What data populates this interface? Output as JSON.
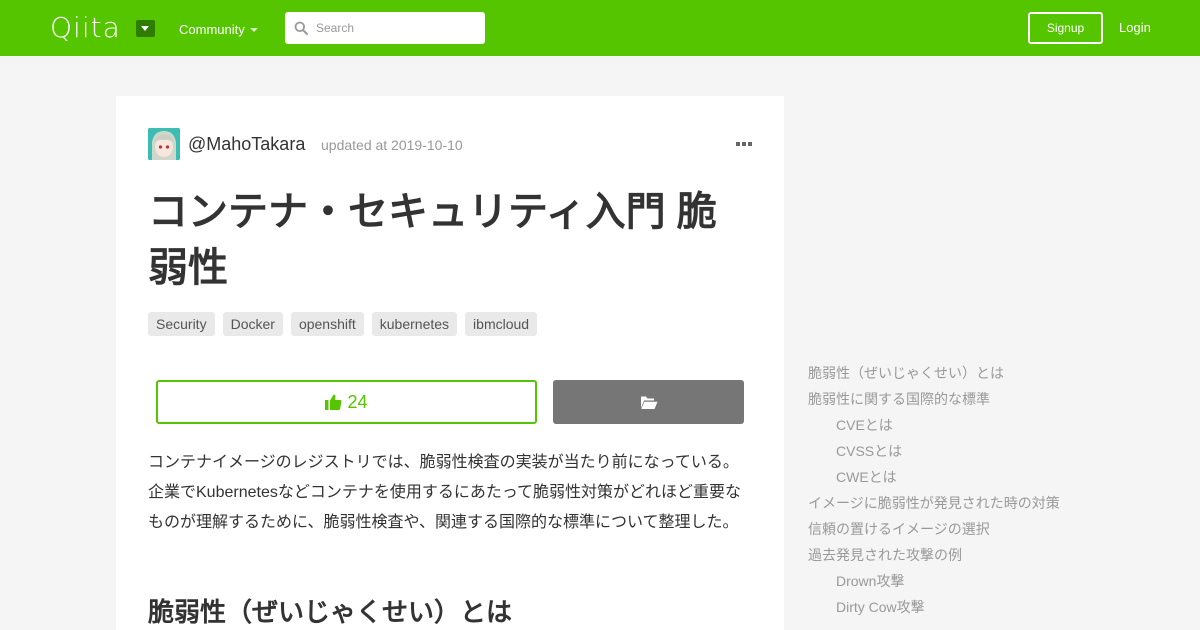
{
  "header": {
    "logo": "Qiita",
    "community_label": "Community",
    "search_placeholder": "Search",
    "signup_label": "Signup",
    "login_label": "Login",
    "brand_color": "#55c500"
  },
  "article": {
    "author": "@MahoTakara",
    "updated": "updated at 2019-10-10",
    "title": "コンテナ・セキュリティ入門 脆弱性",
    "tags": [
      "Security",
      "Docker",
      "openshift",
      "kubernetes",
      "ibmcloud"
    ],
    "likes": "24",
    "intro": "コンテナイメージのレジストリでは、脆弱性検査の実装が当たり前になっている。企業でKubernetesなどコンテナを使用するにあたって脆弱性対策がどれほど重要なものが理解するために、脆弱性検査や、関連する国際的な標準について整理した。",
    "section_heading": "脆弱性（ぜいじゃくせい）とは"
  },
  "toc": [
    {
      "label": "脆弱性（ぜいじゃくせい）とは",
      "level": 1
    },
    {
      "label": "脆弱性に関する国際的な標準",
      "level": 1
    },
    {
      "label": "CVEとは",
      "level": 2
    },
    {
      "label": "CVSSとは",
      "level": 2
    },
    {
      "label": "CWEとは",
      "level": 2
    },
    {
      "label": "イメージに脆弱性が発見された時の対策",
      "level": 1
    },
    {
      "label": "信頼の置けるイメージの選択",
      "level": 1
    },
    {
      "label": "過去発見された攻撃の例",
      "level": 1
    },
    {
      "label": "Drown攻撃",
      "level": 2
    },
    {
      "label": "Dirty Cow攻撃",
      "level": 2
    }
  ]
}
